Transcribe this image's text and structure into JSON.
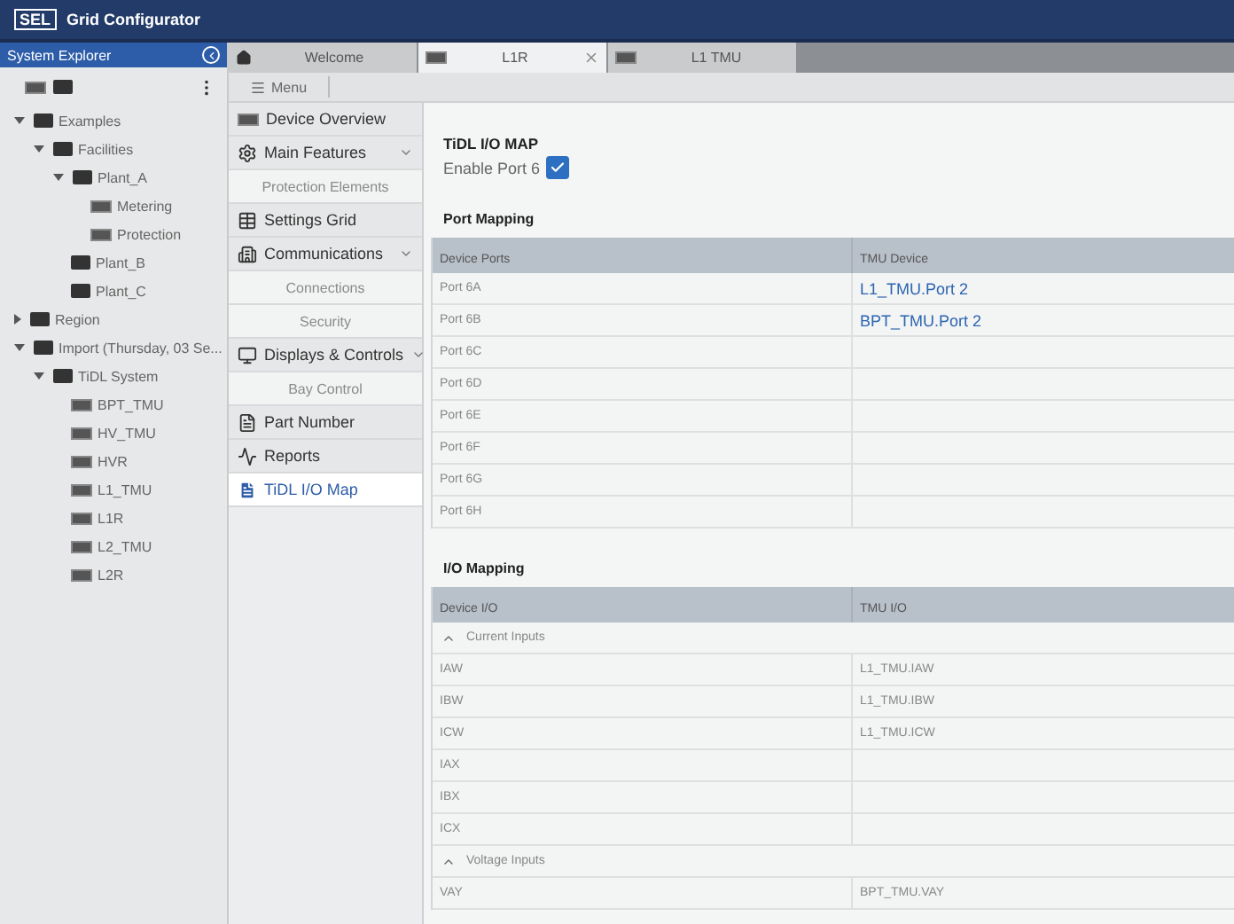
{
  "app": {
    "logo": "SEL",
    "title": "Grid Configurator"
  },
  "explorer": {
    "title": "System Explorer",
    "tree": [
      {
        "label": "Examples",
        "kind": "folder",
        "expanded": true,
        "children": [
          {
            "label": "Facilities",
            "kind": "folder",
            "expanded": true,
            "children": [
              {
                "label": "Plant_A",
                "kind": "folder",
                "expanded": true,
                "children": [
                  {
                    "label": "Metering",
                    "kind": "device"
                  },
                  {
                    "label": "Protection",
                    "kind": "device"
                  }
                ]
              },
              {
                "label": "Plant_B",
                "kind": "folder"
              },
              {
                "label": "Plant_C",
                "kind": "folder"
              }
            ]
          }
        ]
      },
      {
        "label": "Region",
        "kind": "folder",
        "expanded": false
      },
      {
        "label": "Import (Thursday, 03 Se...",
        "kind": "folder",
        "expanded": true,
        "children": [
          {
            "label": "TiDL System",
            "kind": "folder",
            "expanded": true,
            "children": [
              {
                "label": "BPT_TMU",
                "kind": "device"
              },
              {
                "label": "HV_TMU",
                "kind": "device"
              },
              {
                "label": "HVR",
                "kind": "device"
              },
              {
                "label": "L1_TMU",
                "kind": "device"
              },
              {
                "label": "L1R",
                "kind": "device"
              },
              {
                "label": "L2_TMU",
                "kind": "device"
              },
              {
                "label": "L2R",
                "kind": "device"
              }
            ]
          }
        ]
      }
    ]
  },
  "tabs": [
    {
      "label": "Welcome",
      "kind": "home",
      "selected": false
    },
    {
      "label": "L1R",
      "kind": "device",
      "selected": true,
      "closable": true
    },
    {
      "label": "L1 TMU",
      "kind": "device",
      "selected": false
    }
  ],
  "menu": {
    "label": "Menu"
  },
  "nav": [
    {
      "label": "Device Overview",
      "kind": "main",
      "selected": false
    },
    {
      "label": "Main Features",
      "kind": "main",
      "expanded": true,
      "selected": false
    },
    {
      "label": "Protection Elements",
      "kind": "sub",
      "selected": false
    },
    {
      "label": "Settings Grid",
      "kind": "main",
      "selected": false
    },
    {
      "label": "Communications",
      "kind": "main",
      "expanded": true,
      "selected": false
    },
    {
      "label": "Connections",
      "kind": "sub",
      "selected": false
    },
    {
      "label": "Security",
      "kind": "sub",
      "selected": false
    },
    {
      "label": "Displays & Controls",
      "kind": "main",
      "expanded": true,
      "selected": false
    },
    {
      "label": "Bay Control",
      "kind": "sub",
      "selected": false
    },
    {
      "label": "Part Number",
      "kind": "main",
      "selected": false
    },
    {
      "label": "Reports",
      "kind": "main",
      "selected": false
    },
    {
      "label": "TiDL I/O Map",
      "kind": "main",
      "selected": true
    }
  ],
  "page": {
    "title": "TiDL I/O MAP",
    "enable": {
      "label": "Enable Port 6",
      "checked": true
    },
    "port_mapping": {
      "title": "Port Mapping",
      "columns": [
        "Device Ports",
        "TMU Device"
      ],
      "rows": [
        {
          "kind": "row",
          "cells": [
            "Port 6A",
            "L1_TMU.Port 2"
          ]
        },
        {
          "kind": "row",
          "cells": [
            "Port 6B",
            "BPT_TMU.Port 2"
          ]
        },
        {
          "kind": "row",
          "cells": [
            "Port 6C"
          ]
        },
        {
          "kind": "row",
          "cells": [
            "Port 6D"
          ]
        },
        {
          "kind": "row",
          "cells": [
            "Port 6E"
          ]
        },
        {
          "kind": "row",
          "cells": [
            "Port 6F"
          ]
        },
        {
          "kind": "row",
          "cells": [
            "Port 6G"
          ]
        },
        {
          "kind": "row",
          "cells": [
            "Port 6H"
          ]
        }
      ]
    },
    "io_mapping": {
      "title": "I/O Mapping",
      "columns": [
        "Device I/O",
        "TMU I/O"
      ],
      "rows": [
        {
          "kind": "group",
          "label": "Current Inputs",
          "expanded": true
        },
        {
          "kind": "row",
          "cells": [
            "IAW",
            "L1_TMU.IAW"
          ]
        },
        {
          "kind": "row",
          "cells": [
            "IBW",
            "L1_TMU.IBW"
          ]
        },
        {
          "kind": "row",
          "cells": [
            "ICW",
            "L1_TMU.ICW"
          ]
        },
        {
          "kind": "row",
          "cells": [
            "IAX"
          ]
        },
        {
          "kind": "row",
          "cells": [
            "IBX"
          ]
        },
        {
          "kind": "row",
          "cells": [
            "ICX"
          ]
        },
        {
          "kind": "group",
          "label": "Voltage Inputs",
          "expanded": true
        },
        {
          "kind": "row",
          "cells": [
            "VAY",
            "BPT_TMU.VAY"
          ]
        }
      ]
    }
  }
}
